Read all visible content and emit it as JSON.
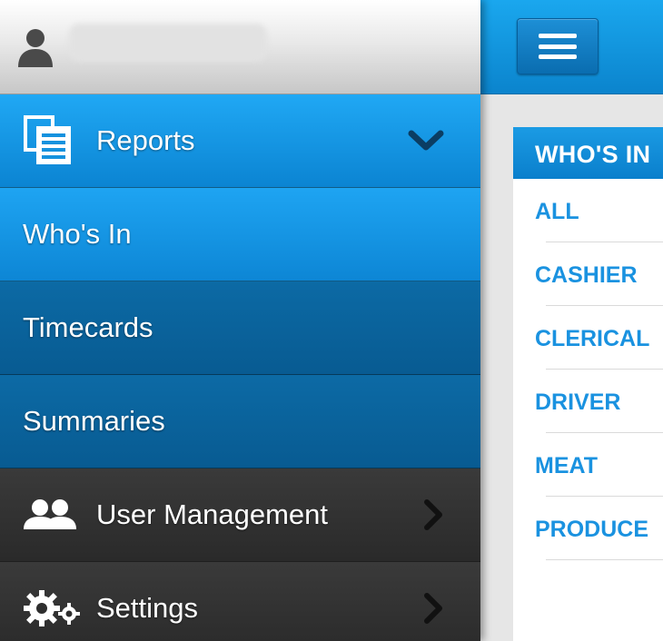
{
  "header": {
    "menu_icon": "hamburger-icon",
    "user_icon": "user-icon"
  },
  "drawer": {
    "reports": {
      "label": "Reports",
      "icon": "report-document-icon",
      "chevron": "chevron-down-icon"
    },
    "sub_items": [
      {
        "label": "Who's In",
        "active": true
      },
      {
        "label": "Timecards",
        "active": false
      },
      {
        "label": "Summaries",
        "active": false
      }
    ],
    "user_management": {
      "label": "User Management",
      "icon": "users-icon",
      "chevron": "chevron-right-icon"
    },
    "settings": {
      "label": "Settings",
      "icon": "gears-icon",
      "chevron": "chevron-right-icon"
    }
  },
  "panel": {
    "title": "WHO'S IN",
    "items": [
      "ALL",
      "CASHIER",
      "CLERICAL",
      "DRIVER",
      "MEAT",
      "PRODUCE"
    ]
  },
  "colors": {
    "accent_blue": "#1aa3ef",
    "dark_blue": "#0a64a0",
    "dark_gray": "#333333",
    "link_blue": "#1a92e0"
  }
}
